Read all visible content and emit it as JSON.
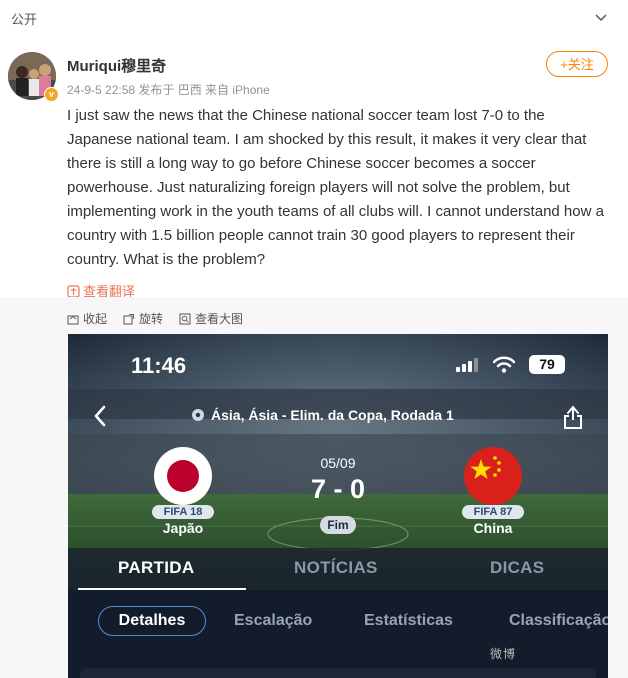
{
  "post": {
    "visibility": "公开",
    "username": "Muriqui穆里奇",
    "meta": "24-9-5 22:58 发布于 巴西 来自 iPhone",
    "follow_label": "+关注",
    "verified_badge": "v",
    "text": "I just saw the news that the Chinese national soccer team lost 7-0 to the Japanese national team. I am shocked by this result, it makes it very clear that there is still a long way to go before Chinese soccer becomes a soccer powerhouse. Just naturalizing foreign players will not solve the problem, but implementing work in the youth teams of all clubs will. I cannot understand how a country with 1.5 billion people cannot train 30 good players to represent their country. What is the problem?",
    "translate_label": "查看翻译"
  },
  "image_tools": {
    "collapse_label": "收起",
    "rotate_label": "旋转",
    "view_large_label": "查看大图"
  },
  "screenshot": {
    "status_time": "11:46",
    "battery": "79",
    "competition": "Ásia, Ásia - Elim. da Copa, Rodada 1",
    "date": "05/09",
    "score": "7 - 0",
    "status": "Fim",
    "home": {
      "name": "Japão",
      "fifa": "FIFA 18"
    },
    "away": {
      "name": "China",
      "fifa": "FIFA 87"
    },
    "tabs": [
      "PARTIDA",
      "NOTÍCIAS",
      "DICAS"
    ],
    "subtabs": [
      "Detalhes",
      "Escalação",
      "Estatísticas",
      "Classificação"
    ]
  },
  "watermark": "微博",
  "colors": {
    "accent_orange": "#ff8200",
    "link_orange": "#eb7350",
    "pill_border": "#4d8fd6",
    "china_red": "#d9201a",
    "japan_red": "#bc002d"
  }
}
